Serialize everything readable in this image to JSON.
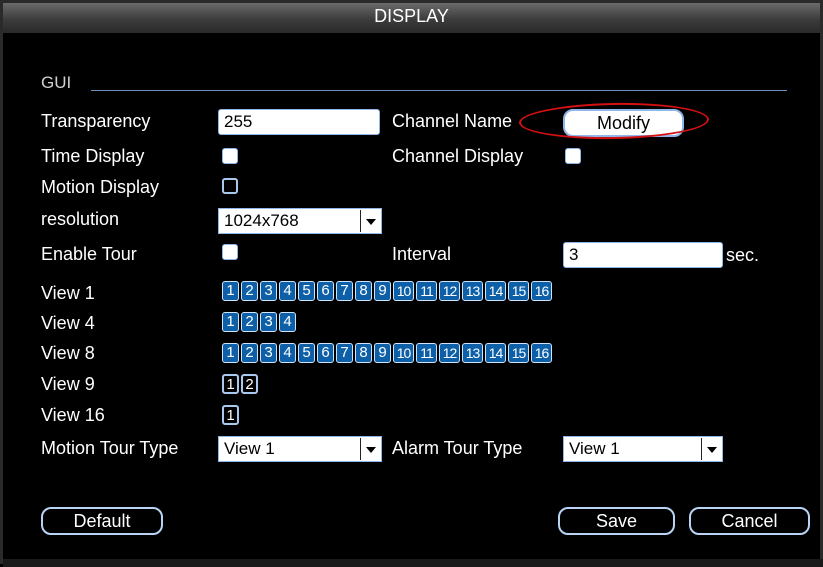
{
  "window": {
    "title": "DISPLAY"
  },
  "gui": {
    "section_label": "GUI",
    "transparency": {
      "label": "Transparency",
      "value": "255"
    },
    "channel_name": {
      "label": "Channel Name",
      "button": "Modify"
    },
    "time_display": {
      "label": "Time Display",
      "checked": true
    },
    "channel_display": {
      "label": "Channel Display",
      "checked": true
    },
    "motion_display": {
      "label": "Motion Display",
      "checked": false
    },
    "resolution": {
      "label": "resolution",
      "value": "1024x768"
    },
    "enable_tour": {
      "label": "Enable Tour",
      "checked": true
    },
    "interval": {
      "label": "Interval",
      "value": "3",
      "unit": "sec."
    }
  },
  "views": [
    {
      "label": "View 1",
      "channels": [
        "1",
        "2",
        "3",
        "4",
        "5",
        "6",
        "7",
        "8",
        "9",
        "10",
        "11",
        "12",
        "13",
        "14",
        "15",
        "16"
      ]
    },
    {
      "label": "View 4",
      "channels": [
        "1",
        "2",
        "3",
        "4"
      ]
    },
    {
      "label": "View 8",
      "channels": [
        "1",
        "2",
        "3",
        "4",
        "5",
        "6",
        "7",
        "8",
        "9",
        "10",
        "11",
        "12",
        "13",
        "14",
        "15",
        "16"
      ]
    },
    {
      "label": "View 9",
      "channels": [
        "1",
        "2"
      ]
    },
    {
      "label": "View 16",
      "channels": [
        "1"
      ]
    }
  ],
  "tour": {
    "motion_label": "Motion Tour Type",
    "motion_value": "View 1",
    "alarm_label": "Alarm Tour Type",
    "alarm_value": "View 1"
  },
  "buttons": {
    "default": "Default",
    "save": "Save",
    "cancel": "Cancel"
  },
  "colors": {
    "accent": "#0d5fa8",
    "highlight_ring": "#d41010",
    "border": "#8fb8e8"
  }
}
